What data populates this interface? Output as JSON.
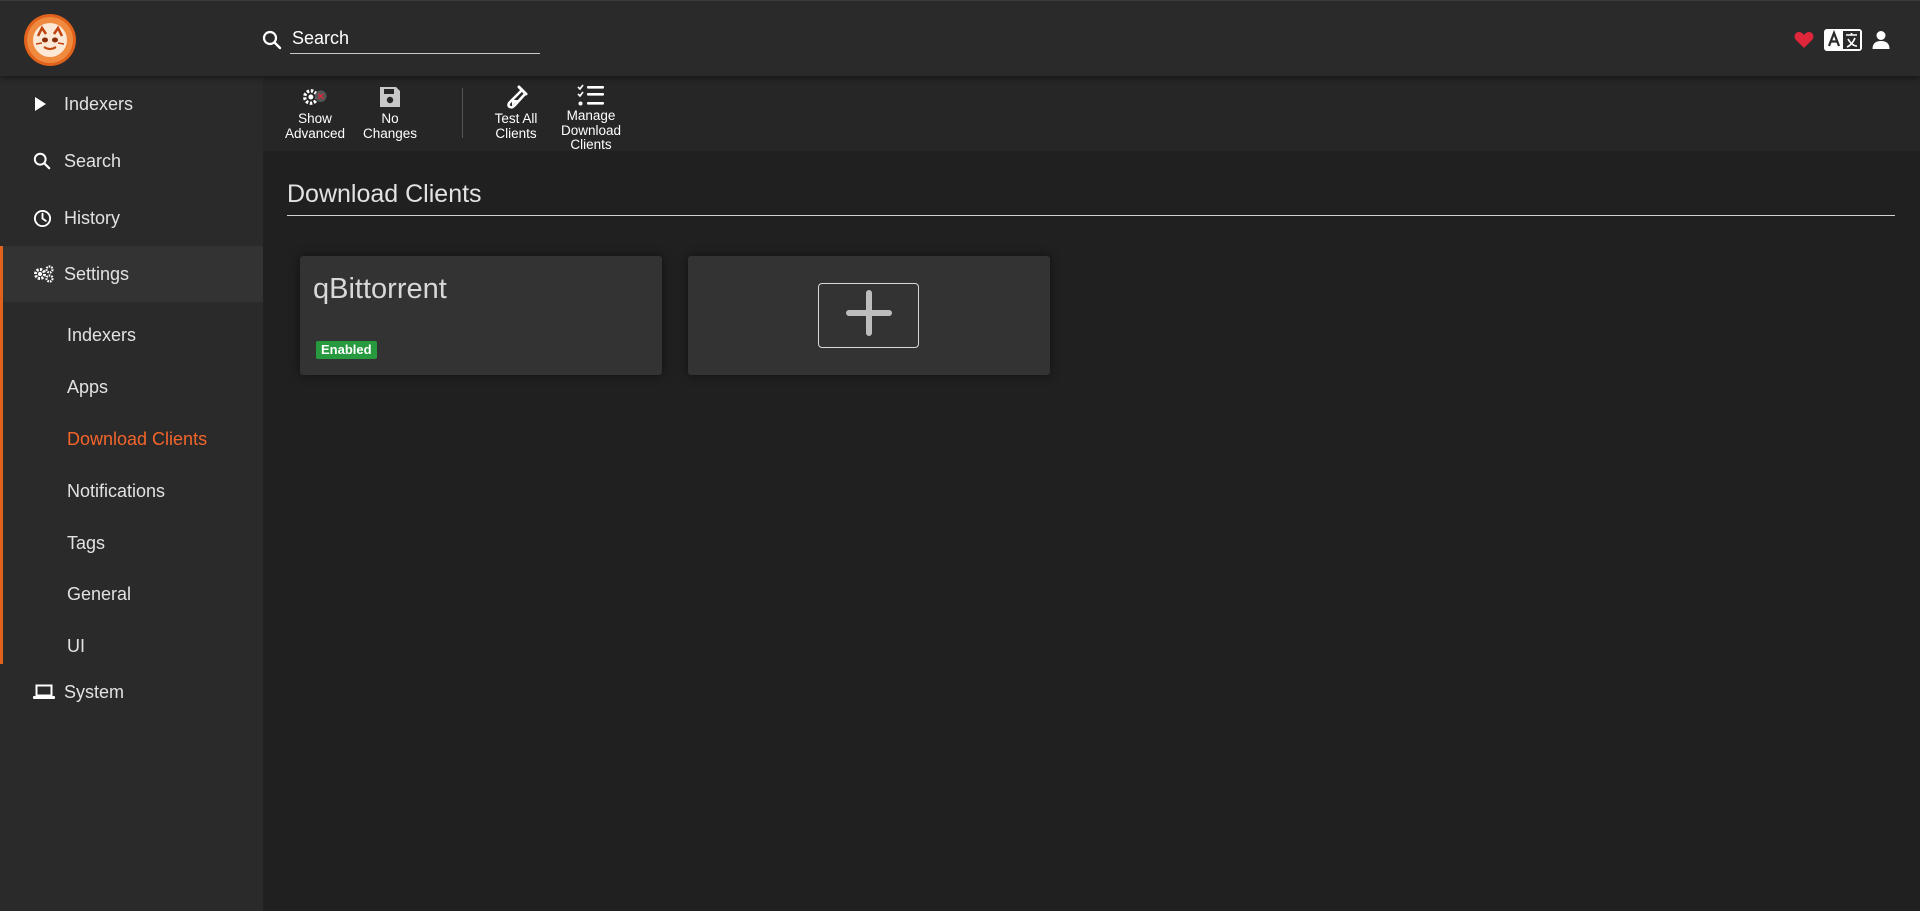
{
  "header": {
    "search_placeholder": "Search",
    "icons": [
      "logo",
      "search-icon",
      "heart-icon",
      "translate-icon",
      "user-icon"
    ],
    "heart_color": "#e0263b"
  },
  "sidebar": {
    "items": [
      {
        "label": "Indexers",
        "icon": "play-icon"
      },
      {
        "label": "Search",
        "icon": "search-icon"
      },
      {
        "label": "History",
        "icon": "history-icon"
      },
      {
        "label": "Settings",
        "icon": "cogs-icon",
        "active": true
      },
      {
        "label": "System",
        "icon": "laptop-icon"
      }
    ],
    "settings_sub": [
      {
        "label": "Indexers"
      },
      {
        "label": "Apps"
      },
      {
        "label": "Download Clients",
        "active": true
      },
      {
        "label": "Notifications"
      },
      {
        "label": "Tags"
      },
      {
        "label": "General"
      },
      {
        "label": "UI"
      }
    ],
    "accent_color": "#e1621c",
    "active_color": "#f3652b"
  },
  "toolbar": {
    "show_advanced": "Show Advanced",
    "no_changes": "No Changes",
    "test_all": "Test All Clients",
    "manage": "Manage Download Clients"
  },
  "main": {
    "title": "Download Clients",
    "clients": [
      {
        "name": "qBittorrent",
        "status": "Enabled"
      }
    ],
    "add_icon": "plus-icon",
    "enabled_color": "#279a3f"
  }
}
